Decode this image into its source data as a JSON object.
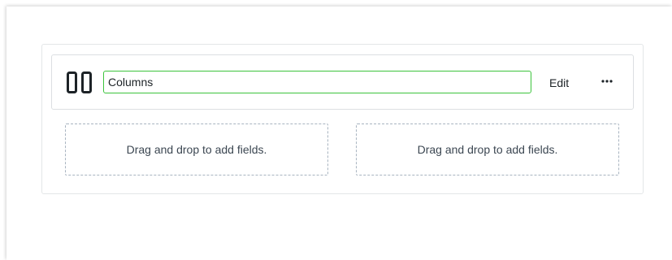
{
  "block": {
    "icon": "columns-icon",
    "name_value": "Columns",
    "edit_label": "Edit",
    "more_icon": "ellipsis-icon"
  },
  "columns": [
    {
      "placeholder": "Drag and drop to add fields."
    },
    {
      "placeholder": "Drag and drop to add fields."
    }
  ],
  "colors": {
    "input_border_focus": "#3cc43c",
    "icon": "#1d2327",
    "drop_zone_border": "#a8b4c0"
  }
}
